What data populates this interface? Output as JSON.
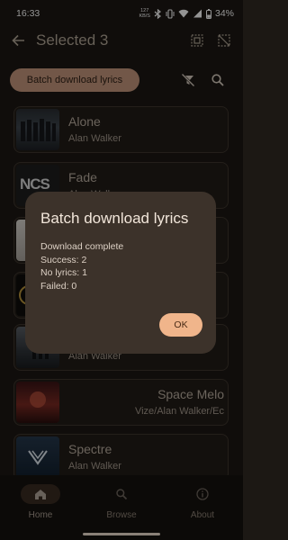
{
  "status_bar": {
    "time": "16:33",
    "net_speed_value": "127",
    "net_speed_unit": "KB/S",
    "battery": "34%"
  },
  "top_bar": {
    "title": "Selected 3"
  },
  "actions": {
    "batch_download_label": "Batch download lyrics"
  },
  "songs": [
    {
      "title": "Alone",
      "artist": "Alan Walker"
    },
    {
      "title": "Fade",
      "artist": "Alan Walker"
    },
    {
      "title": "",
      "artist": ""
    },
    {
      "title": "",
      "artist": ""
    },
    {
      "title": "",
      "artist": "Alan Walker"
    },
    {
      "title": "Space Melo",
      "artist": "Vize/Alan Walker/Ec"
    },
    {
      "title": "Spectre",
      "artist": "Alan Walker"
    }
  ],
  "thumb_text": {
    "ncs": "NCS"
  },
  "dialog": {
    "title": "Batch download lyrics",
    "lines": [
      "Download complete",
      "Success: 2",
      "No lyrics: 1",
      "Failed: 0"
    ],
    "ok_label": "OK"
  },
  "bottom_nav": [
    {
      "label": "Home",
      "icon": "home-icon",
      "active": true
    },
    {
      "label": "Browse",
      "icon": "search-icon",
      "active": false
    },
    {
      "label": "About",
      "icon": "info-icon",
      "active": false
    }
  ],
  "colors": {
    "background": "#1c1814",
    "accent_button": "#c5977c",
    "dialog": "#3c322a",
    "ok_button": "#f0b58b"
  }
}
